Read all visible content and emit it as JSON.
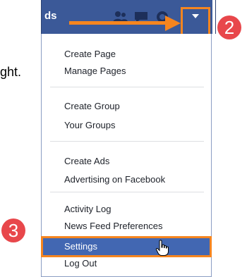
{
  "doc": {
    "partial_text": "ght."
  },
  "topbar": {
    "partial_label": "ds"
  },
  "menu": {
    "items": [
      "Create Page",
      "Manage Pages",
      "Create Group",
      "Your Groups",
      "Create Ads",
      "Advertising on Facebook",
      "Activity Log",
      "News Feed Preferences",
      "Settings",
      "Log Out"
    ]
  },
  "callouts": {
    "step2": "2",
    "step3": "3"
  },
  "colors": {
    "facebook_blue": "#3b5998",
    "highlight_blue": "#4267b2",
    "callout_orange": "#f5851f",
    "badge_red": "#e8474b"
  },
  "icons": [
    "friends-icon",
    "messages-icon",
    "notifications-icon",
    "account-menu-arrow-icon"
  ]
}
